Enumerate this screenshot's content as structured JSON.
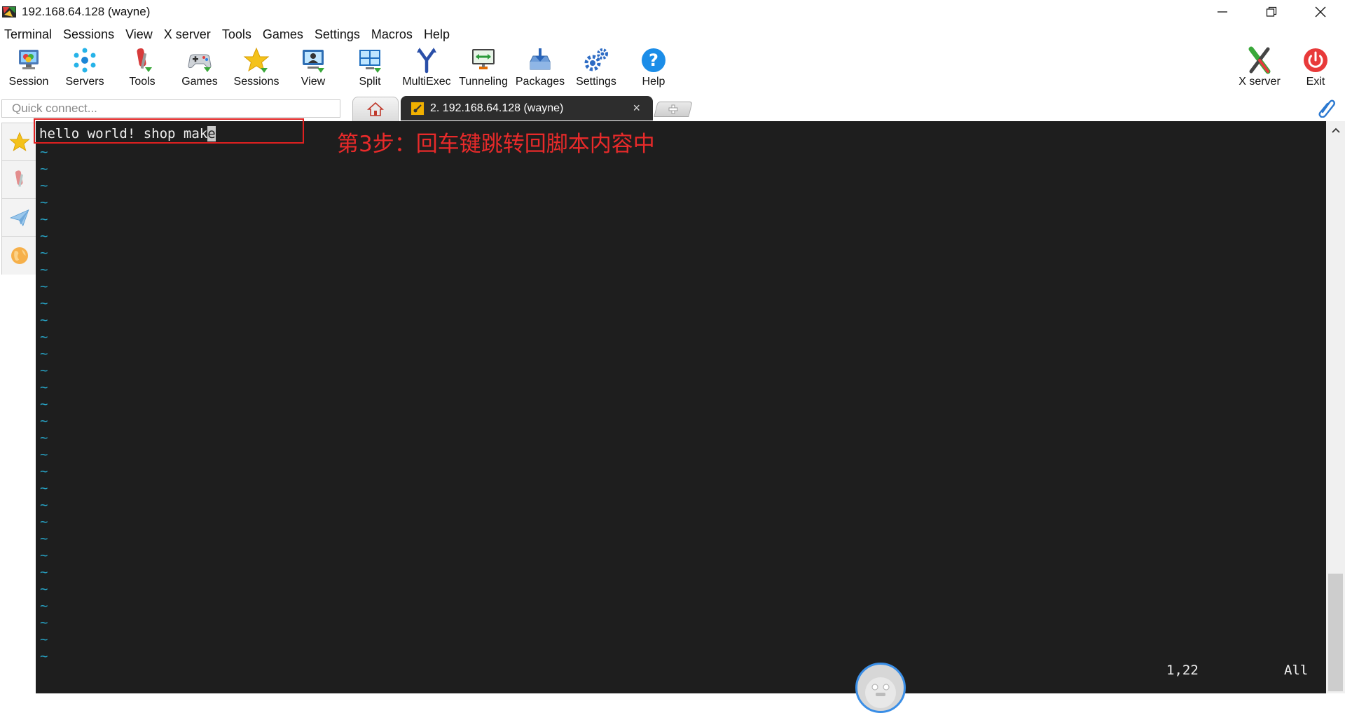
{
  "window": {
    "title": "192.168.64.128 (wayne)"
  },
  "menu": [
    "Terminal",
    "Sessions",
    "View",
    "X server",
    "Tools",
    "Games",
    "Settings",
    "Macros",
    "Help"
  ],
  "toolbar": {
    "left": [
      {
        "label": "Session",
        "icon": "session-icon"
      },
      {
        "label": "Servers",
        "icon": "servers-icon"
      },
      {
        "label": "Tools",
        "icon": "tools-icon"
      },
      {
        "label": "Games",
        "icon": "games-icon"
      },
      {
        "label": "Sessions",
        "icon": "sessions-star-icon"
      },
      {
        "label": "View",
        "icon": "view-icon"
      },
      {
        "label": "Split",
        "icon": "split-icon"
      },
      {
        "label": "MultiExec",
        "icon": "multiexec-icon"
      },
      {
        "label": "Tunneling",
        "icon": "tunneling-icon"
      },
      {
        "label": "Packages",
        "icon": "packages-icon"
      },
      {
        "label": "Settings",
        "icon": "settings-icon"
      },
      {
        "label": "Help",
        "icon": "help-icon"
      }
    ],
    "right": [
      {
        "label": "X server",
        "icon": "x-server-icon"
      },
      {
        "label": "Exit",
        "icon": "power-icon"
      }
    ]
  },
  "quick_connect": {
    "placeholder": "Quick connect..."
  },
  "tabs": {
    "active_label": "2. 192.168.64.128 (wayne)",
    "close_glyph": "×"
  },
  "terminal": {
    "line_text": "hello world! shop mak",
    "cursor_char": "e",
    "tilde": "~",
    "tilde_count": 31,
    "annotation": "第3步：回车键跳转回脚本内容中",
    "cursor_position": "1,22",
    "scroll_status": "All"
  },
  "colors": {
    "terminal_bg": "#1e1e1e",
    "tilde": "#27a2c4",
    "annotation": "#e82a2a",
    "tab_active": "#2d2d2d"
  }
}
